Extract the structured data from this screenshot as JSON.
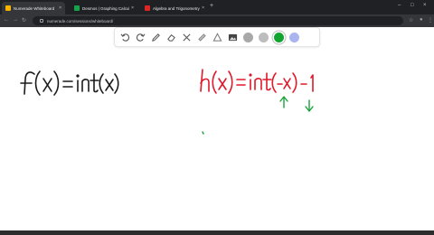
{
  "browser": {
    "tabs": [
      {
        "title": "Numerade Whiteboard",
        "active": true,
        "favicon_color": "#f4b400"
      },
      {
        "title": "Desmos | Graphing Calculator",
        "active": false,
        "favicon_color": "#16a34a"
      },
      {
        "title": "Algebra and Trigonometry by Ro",
        "active": false,
        "favicon_color": "#dc2626"
      }
    ],
    "close_glyph": "×",
    "new_tab_glyph": "+",
    "url": "numerade.com/sessions/whiteboard/"
  },
  "toolbar": {
    "tools": [
      "undo-icon",
      "redo-icon",
      "pen-icon",
      "eraser-icon",
      "tools-icon",
      "highlighter-icon",
      "shape-icon",
      "image-icon"
    ],
    "colors": [
      {
        "name": "gray",
        "hex": "#a8a8a8",
        "selected": false
      },
      {
        "name": "gray-light",
        "hex": "#bdbdbd",
        "selected": false
      },
      {
        "name": "green",
        "hex": "#12a430",
        "selected": true
      },
      {
        "name": "lavender",
        "hex": "#aab4ee",
        "selected": false
      }
    ]
  },
  "whiteboard": {
    "left_expression": "f(x) = int(x)",
    "right_expression": "h(x) = int(-x) - 1",
    "ink_colors": {
      "black": "#1a1a1a",
      "red": "#e0182a",
      "green": "#17a33a"
    }
  }
}
